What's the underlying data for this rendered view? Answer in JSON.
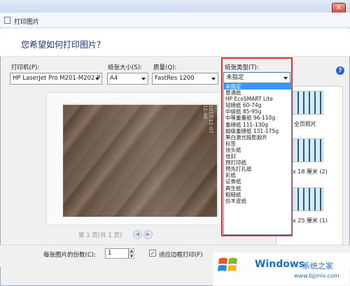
{
  "window": {
    "title": "打印图片",
    "close_glyph": "✕"
  },
  "heading": "您希望如何打印图片?",
  "printer": {
    "label": "打印机(P):",
    "value": "HP LaserJet Pro M201-M202 P"
  },
  "paper_size": {
    "label": "纸张大小(S):",
    "value": "A4"
  },
  "quality": {
    "label": "质量(Q):",
    "value": "FastRes 1200"
  },
  "paper_type": {
    "label": "纸张类型(T):",
    "value": "未指定",
    "options": [
      "未指定",
      "普通纸",
      "HP EcoSMART Lite",
      "轻磅纸 60-74g",
      "中级纸 85-95g",
      "中等重量纸 96-110g",
      "重磅纸 111-130g",
      "超级重磅纸 131-175g",
      "黑白激光投影胶片",
      "标签",
      "信头纸",
      "信封",
      "预打印纸",
      "预先打孔纸",
      "彩纸",
      "证券纸",
      "再生纸",
      "粗糙纸",
      "仿羊皮纸"
    ],
    "selected_index": 0
  },
  "preview": {
    "photo_date": "2017-12-07 11:46",
    "page_info": "第 1 页(共 1 页)"
  },
  "layouts": [
    {
      "label": "全页照片"
    },
    {
      "label": "x 18 厘米 (2)"
    },
    {
      "label": "x 25 厘米 (1)"
    }
  ],
  "copies": {
    "label": "每张图片的份数(C):",
    "value": "1"
  },
  "fit_frame": {
    "label": "适应边框打印(F)",
    "checked": true
  },
  "watermark": {
    "brand": "Windows",
    "brand_cn": "系统之家",
    "url": "www.bjjmlv.com"
  },
  "colors": {
    "accent": "#3399ff",
    "highlight": "#d8322f",
    "heading": "#1e3287"
  }
}
